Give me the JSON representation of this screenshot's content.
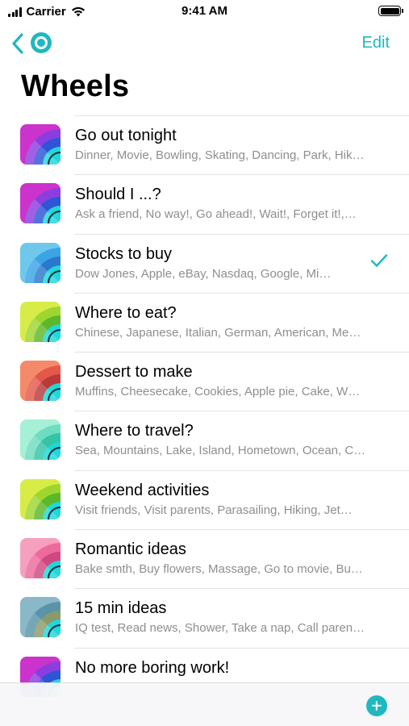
{
  "status_bar": {
    "carrier": "Carrier",
    "time": "9:41 AM"
  },
  "nav": {
    "back_icon": "chevron-left-icon",
    "app_icon": "wheel-logo-icon",
    "edit_label": "Edit"
  },
  "page_title": "Wheels",
  "accent_color": "#1fb8c0",
  "wheels": [
    {
      "title": "Go out tonight",
      "subtitle": "Dinner, Movie, Bowling, Skating, Dancing, Park, Hik…",
      "colors": [
        "#cc33cc",
        "#8a3ee0",
        "#2d55d6",
        "#1fd8d8"
      ],
      "selected": false
    },
    {
      "title": "Should I ...?",
      "subtitle": "Ask a friend, No way!, Go ahead!, Wait!, Forget it!,…",
      "colors": [
        "#cc33cc",
        "#8a3ee0",
        "#2d55d6",
        "#1fd8d8"
      ],
      "selected": false
    },
    {
      "title": "Stocks to buy",
      "subtitle": "Dow Jones, Apple, eBay, Nasdaq, Google, Mi…",
      "colors": [
        "#6ec8ec",
        "#3aa4e6",
        "#2a78cc",
        "#1fd8d8"
      ],
      "selected": true
    },
    {
      "title": "Where to eat?",
      "subtitle": "Chinese, Japanese, Italian, German, American, Me…",
      "colors": [
        "#d8ec48",
        "#9ed630",
        "#5cb82a",
        "#1fd8d8"
      ],
      "selected": false
    },
    {
      "title": "Dessert to make",
      "subtitle": "Muffins, Cheesecake, Cookies, Apple pie, Cake, W…",
      "colors": [
        "#f48a6a",
        "#e4584a",
        "#b83a3a",
        "#1fd8d8"
      ],
      "selected": false
    },
    {
      "title": "Where to travel?",
      "subtitle": "Sea, Mountains, Lake, Island, Hometown, Ocean, C…",
      "colors": [
        "#a6f0d6",
        "#6edcc0",
        "#34c4a6",
        "#1fd8d8"
      ],
      "selected": false
    },
    {
      "title": "Weekend activities",
      "subtitle": "Visit friends, Visit parents, Parasailing, Hiking, Jet…",
      "colors": [
        "#d8ec48",
        "#9ed630",
        "#5cb82a",
        "#1fd8d8"
      ],
      "selected": false
    },
    {
      "title": "Romantic ideas",
      "subtitle": "Bake smth, Buy flowers, Massage, Go to movie, Bu…",
      "colors": [
        "#f6a0c0",
        "#ee6a9c",
        "#d04880",
        "#1fd8d8"
      ],
      "selected": false
    },
    {
      "title": "15 min ideas",
      "subtitle": "IQ test, Read news, Shower, Take a nap, Call paren…",
      "colors": [
        "#8ab8c8",
        "#5a94a8",
        "#8a9a6a",
        "#1fd8d8"
      ],
      "selected": false
    },
    {
      "title": "No more boring work!",
      "subtitle": "",
      "colors": [
        "#cc33cc",
        "#8a3ee0",
        "#2d55d6",
        "#1fd8d8"
      ],
      "selected": false
    }
  ],
  "tab_bar": {
    "add_icon": "plus-circle-icon"
  }
}
